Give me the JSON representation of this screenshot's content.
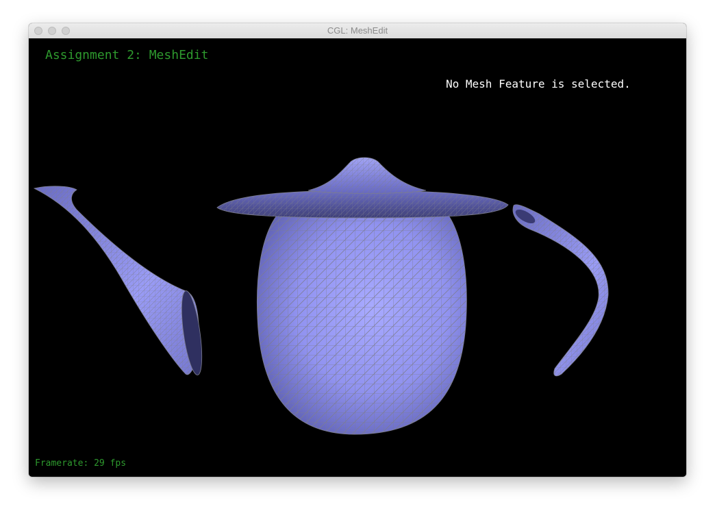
{
  "window": {
    "title": "CGL: MeshEdit"
  },
  "viewport": {
    "assignment_title": "Assignment 2: MeshEdit",
    "selection_status": "No Mesh Feature is selected.",
    "framerate": "Framerate: 29 fps"
  },
  "colors": {
    "mesh_fill": "#9a9cf6",
    "mesh_wire": "#7a7a8a",
    "overlay_green": "#2e9a2e",
    "background": "#000000"
  },
  "icons": {
    "close": "close-icon",
    "minimize": "minimize-icon",
    "zoom": "zoom-icon"
  }
}
